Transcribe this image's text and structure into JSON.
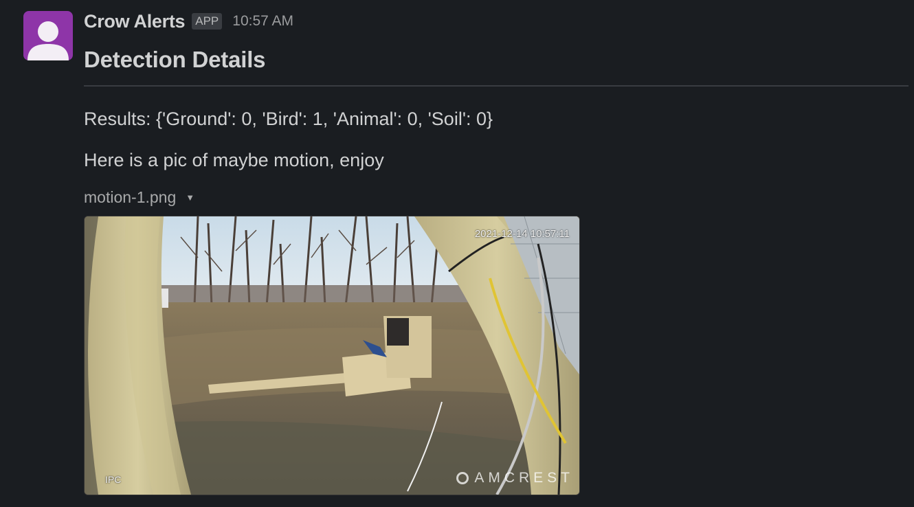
{
  "message": {
    "sender": "Crow Alerts",
    "badge": "APP",
    "time": "10:57 AM",
    "title": "Detection Details",
    "results": "Results: {'Ground': 0, 'Bird': 1, 'Animal': 0, 'Soil': 0}",
    "body": "Here is a pic of maybe motion, enjoy",
    "attachment": {
      "filename": "motion-1.png",
      "timestamp_overlay": "2021-12-14 10:57:11",
      "camera_label": "IPC",
      "brand_watermark": "AMCREST"
    }
  },
  "icons": {
    "avatar": "user-silhouette-icon",
    "file_menu": "caret-down-icon"
  },
  "colors": {
    "background": "#1a1d21",
    "avatar": "#8e35a8",
    "text": "#d1d2d3"
  }
}
